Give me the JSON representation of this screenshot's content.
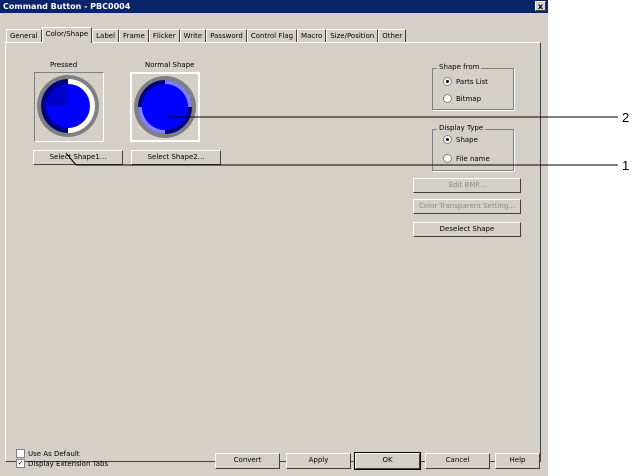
{
  "window": {
    "title": "Command Button - PBC0004",
    "close_label": "x"
  },
  "tabs": [
    {
      "label": "General"
    },
    {
      "label": "Color/Shape",
      "active": true
    },
    {
      "label": "Label"
    },
    {
      "label": "Frame"
    },
    {
      "label": "Flicker"
    },
    {
      "label": "Write"
    },
    {
      "label": "Password"
    },
    {
      "label": "Control Flag"
    },
    {
      "label": "Macro"
    },
    {
      "label": "Size/Position"
    },
    {
      "label": "Other"
    }
  ],
  "shapes": {
    "pressed_label": "Pressed",
    "normal_label": "Normal Shape",
    "select1": "Select Shape1...",
    "select2": "Select Shape2..."
  },
  "shape_from": {
    "legend": "Shape from",
    "options": [
      {
        "label": "Parts List",
        "checked": true
      },
      {
        "label": "Bitmap",
        "checked": false
      }
    ]
  },
  "display_type": {
    "legend": "Display Type",
    "options": [
      {
        "label": "Shape",
        "checked": true
      },
      {
        "label": "File name",
        "checked": false
      }
    ]
  },
  "side_buttons": {
    "edit_bmp": "Edit BMP...",
    "color_transparent": "Color Transparent Setting...",
    "deselect": "Deselect Shape"
  },
  "checks": {
    "use_as_default": {
      "label": "Use As Default",
      "checked": false
    },
    "display_ext_tabs": {
      "label": "Display Extension Tabs",
      "checked": true
    }
  },
  "bottom_buttons": {
    "convert": "Convert",
    "apply": "Apply",
    "ok": "OK",
    "cancel": "Cancel",
    "help": "Help"
  },
  "callouts": {
    "one": "1",
    "two": "2"
  },
  "colors": {
    "title_bar": "#0a246a",
    "face": "#d4d0c8",
    "shape_blue": "#0000ff",
    "ring_gray": "#808080"
  }
}
